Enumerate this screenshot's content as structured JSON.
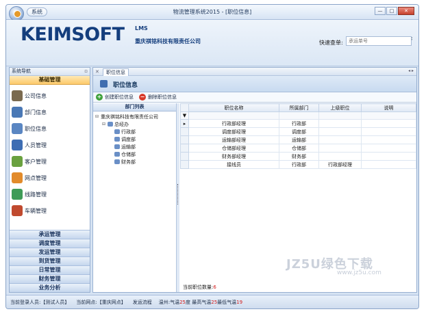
{
  "window": {
    "system_button": "系统",
    "title": "物流管理系统2015 - [职位信息]",
    "ctrl_min": "—",
    "ctrl_max": "□",
    "ctrl_close": "✕",
    "sub_ctrls": [
      "—",
      "▫",
      "✕"
    ]
  },
  "banner": {
    "logo": "KEIMSOFT",
    "product": "LMS",
    "company": "重庆祺铭科技有限责任公司",
    "search_label": "快速查单:",
    "search_placeholder": "承运单号"
  },
  "nav": {
    "header": "系统导航",
    "pin": "▫",
    "active_group": "基础管理",
    "items": [
      {
        "label": "公司信息",
        "icon": "building-icon",
        "color": "#7a6a4f"
      },
      {
        "label": "部门信息",
        "icon": "people-group-icon",
        "color": "#4a78b5"
      },
      {
        "label": "职位信息",
        "icon": "people-icon",
        "color": "#5a86c2"
      },
      {
        "label": "人员管理",
        "icon": "person-icon",
        "color": "#3d6db3"
      },
      {
        "label": "客户管理",
        "icon": "customer-icon",
        "color": "#6aa13f"
      },
      {
        "label": "网点管理",
        "icon": "network-icon",
        "color": "#e28b2b"
      },
      {
        "label": "线路管理",
        "icon": "route-icon",
        "color": "#3e9b57"
      },
      {
        "label": "车辆管理",
        "icon": "truck-icon",
        "color": "#c04a2f"
      }
    ],
    "groups": [
      "承运管理",
      "调度管理",
      "发运管理",
      "到货管理",
      "日常管理",
      "财务管理",
      "业务分析"
    ]
  },
  "main": {
    "tab_label": "职位信息",
    "tab_close": "✕",
    "tab_nav": "◂ ▸",
    "page_title": "职位信息",
    "toolbar": {
      "create_label": "创建职位信息",
      "create_symbol": "+",
      "delete_label": "删除职位信息",
      "delete_symbol": "−"
    },
    "dept_header": "部门列表",
    "tree": {
      "root": "重庆祺铭科技有限责任公司",
      "child": "总经办",
      "leaves": [
        "行政部",
        "调度部",
        "运输部",
        "仓储部",
        "财务部"
      ],
      "expander": "⊟"
    },
    "grid": {
      "columns": [
        "职位名称",
        "所属部门",
        "上级职位",
        "说明"
      ],
      "filter_symbol": "▼",
      "current_row_marker": "▸",
      "rows": [
        [
          "行政部经理",
          "行政部",
          "",
          ""
        ],
        [
          "调度部经理",
          "调度部",
          "",
          ""
        ],
        [
          "运输部经理",
          "运输部",
          "",
          ""
        ],
        [
          "仓储部经理",
          "仓储部",
          "",
          ""
        ],
        [
          "财务部经理",
          "财务部",
          "",
          ""
        ],
        [
          "接线员",
          "行政部",
          "行政部经理",
          ""
        ]
      ]
    },
    "count_label": "当前职位数量:",
    "count_value": "6"
  },
  "statusbar": {
    "login_label": "当前登录人员:",
    "login_value": "【测试人员】",
    "site_label": "当前网点:",
    "site_value": "【重庆网点】",
    "flow": "发运流程",
    "weather_prefix": "温州:气温",
    "temp": "25",
    "weather_mid1": "度 最高气温",
    "temp_high": "25",
    "weather_mid2": "最低气温",
    "temp_low": "19"
  },
  "watermark": {
    "main": "JZ5U绿色下载",
    "url": "www.jz5u.com"
  }
}
